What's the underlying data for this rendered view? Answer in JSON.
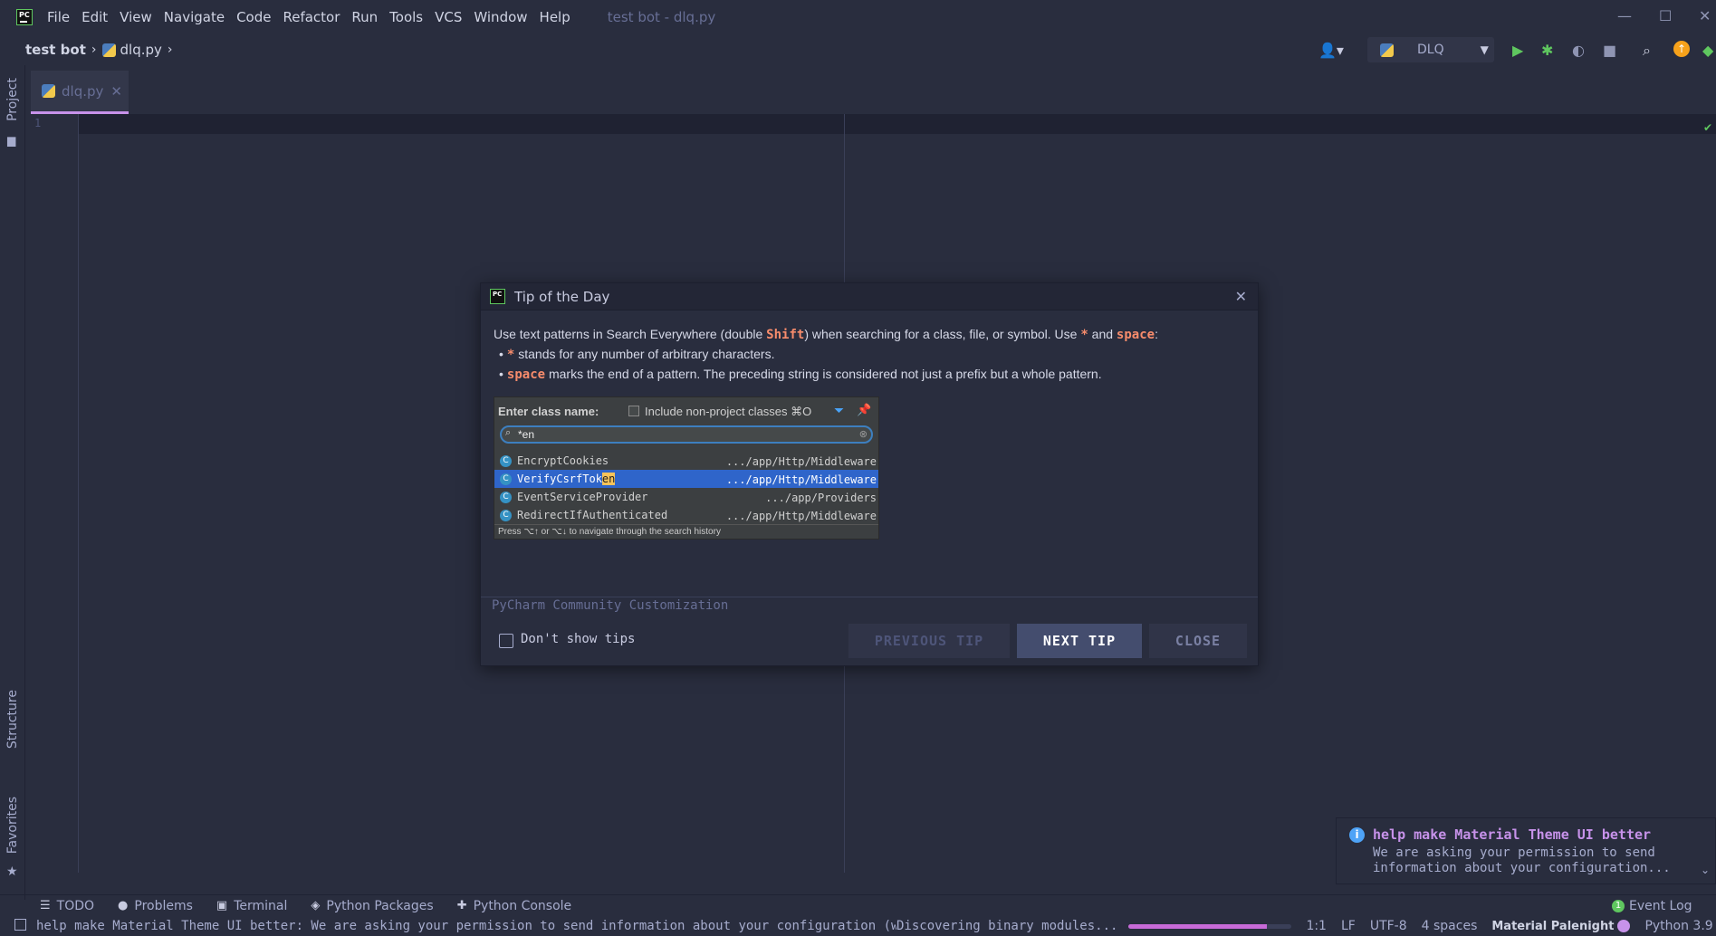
{
  "menubar": {
    "items": [
      "File",
      "Edit",
      "View",
      "Navigate",
      "Code",
      "Refactor",
      "Run",
      "Tools",
      "VCS",
      "Window",
      "Help"
    ],
    "window_title": "test bot - dlq.py"
  },
  "navbar": {
    "project": "test bot",
    "file": "dlq.py",
    "run_config": "DLQ"
  },
  "left_stripe": {
    "project": "Project",
    "structure": "Structure",
    "favorites": "Favorites"
  },
  "editor": {
    "tab_label": "dlq.py",
    "line_number": "1"
  },
  "dialog": {
    "title": "Tip of the Day",
    "line1_pre": "Use text patterns in Search Everywhere (double ",
    "kw_shift": "Shift",
    "line1_mid": ") when searching for a class, file, or symbol. Use ",
    "kw_star": "*",
    "line1_and": " and ",
    "kw_space": "space",
    "line1_end": ":",
    "bullet1_rest": " stands for any number of arbitrary characters.",
    "bullet2_rest": " marks the end of a pattern. The preceding string is considered not just a prefix but a whole pattern.",
    "customization": "PyCharm Community Customization",
    "dont_show": "Don't show tips",
    "prev_button": "PREVIOUS TIP",
    "next_button": "NEXT TIP",
    "close_button": "CLOSE"
  },
  "example": {
    "header": "Enter class name:",
    "include_label": "Include non-project classes ⌘O",
    "search_value": "*en",
    "rows": [
      {
        "name": "EncryptCookies",
        "name_pre": "EncryptCookies",
        "name_hl": "",
        "path": ".../app/Http/Middleware",
        "selected": false
      },
      {
        "name": "VerifyCsrfToken",
        "name_pre": "VerifyCsrfTok",
        "name_hl": "en",
        "path": ".../app/Http/Middleware",
        "selected": true
      },
      {
        "name": "EventServiceProvider",
        "name_pre": "EventServiceProvider",
        "name_hl": "",
        "path": ".../app/Providers",
        "selected": false
      },
      {
        "name": "RedirectIfAuthenticated",
        "name_pre": "RedirectIfAuthenticated",
        "name_hl": "",
        "path": ".../app/Http/Middleware",
        "selected": false
      }
    ],
    "footer": "Press ⌥↑ or ⌥↓ to navigate through the search history"
  },
  "bottom_tabs": [
    "TODO",
    "Problems",
    "Terminal",
    "Python Packages",
    "Python Console"
  ],
  "event_log": "Event Log",
  "event_log_count": "1",
  "notification": {
    "title": "help make Material Theme UI better",
    "body": "We are asking your permission to send information about your configuration..."
  },
  "status_bar": {
    "message": "help make Material Theme UI better: We are asking your permission to send information about your configuration (wh...",
    "progress_text": "Discovering binary modules...",
    "progress": 0.85,
    "position": "1:1",
    "line_sep": "LF",
    "encoding": "UTF-8",
    "indent": "4 spaces",
    "theme": "Material Palenight",
    "interpreter": "Python 3.9"
  },
  "colors": {
    "background": "#292d3e",
    "accent": "#c792ea",
    "keyword": "#f78c6c",
    "selection": "#2f65ca"
  }
}
